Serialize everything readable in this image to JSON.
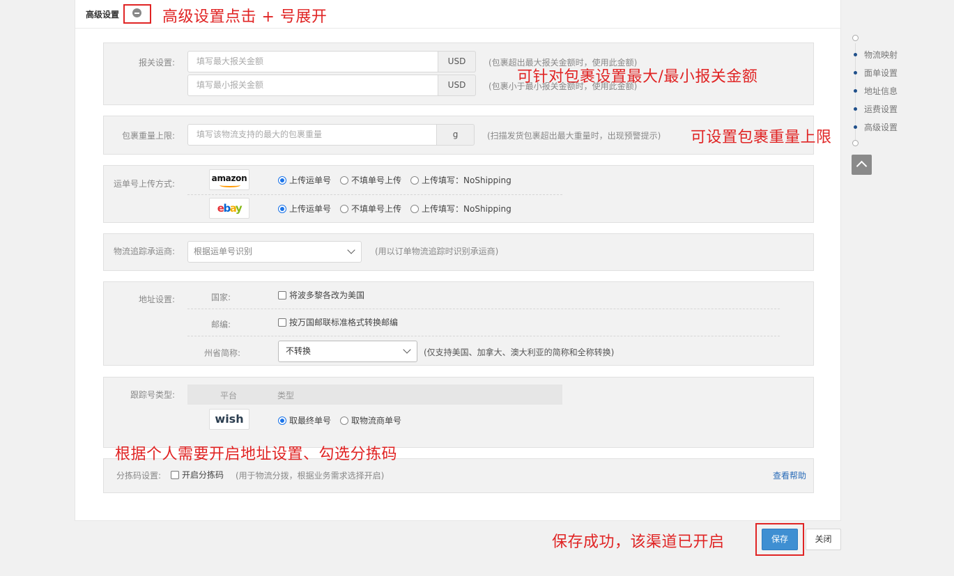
{
  "header": {
    "title": "高级设置",
    "toggle_icon": "minus-circle-icon"
  },
  "customs": {
    "label": "报关设置:",
    "max_placeholder": "填写最大报关金额",
    "min_placeholder": "填写最小报关金额",
    "currency": "USD",
    "max_hint": "(包裹超出最大报关金额时，使用此金额)",
    "min_hint": "(包裹小于最小报关金额时，使用此金额)"
  },
  "weight": {
    "label": "包裹重量上限:",
    "placeholder": "填写该物流支持的最大的包裹重量",
    "unit": "g",
    "hint": "(扫描发货包裹超出最大重量时，出现预警提示)"
  },
  "upload": {
    "label": "运单号上传方式:",
    "platforms": [
      {
        "logo": "amazon",
        "options": [
          "上传运单号",
          "不填单号上传",
          "上传填写：NoShipping"
        ],
        "selected": 0
      },
      {
        "logo": "ebay",
        "options": [
          "上传运单号",
          "不填单号上传",
          "上传填写：NoShipping"
        ],
        "selected": 0
      }
    ]
  },
  "carrier": {
    "label": "物流追踪承运商:",
    "value": "根据运单号识别",
    "hint": "(用以订单物流追踪时识别承运商)"
  },
  "address": {
    "label": "地址设置:",
    "country_label": "国家:",
    "country_option": "将波多黎各改为美国",
    "zip_label": "邮编:",
    "zip_option": "按万国邮联标准格式转换邮编",
    "state_label": "州省简称:",
    "state_value": "不转换",
    "state_hint": "(仅支持美国、加拿大、澳大利亚的简称和全称转换)"
  },
  "tracking": {
    "label": "跟踪号类型:",
    "col_platform": "平台",
    "col_type": "类型",
    "logo": "wish",
    "options": [
      "取最终单号",
      "取物流商单号"
    ],
    "selected": 0
  },
  "sorting": {
    "label": "分拣码设置:",
    "option": "开启分拣码",
    "hint": "(用于物流分拨，根据业务需求选择开启)",
    "help": "查看帮助"
  },
  "footer": {
    "save": "保存",
    "close": "关闭"
  },
  "sidenav": {
    "items": [
      "物流映射",
      "面单设置",
      "地址信息",
      "运费设置",
      "高级设置"
    ]
  },
  "annotations": {
    "expand": "高级设置点击 + 号展开",
    "customs": "可针对包裹设置最大/最小报关金额",
    "weight": "可设置包裹重量上限",
    "address": "根据个人需要开启地址设置、勾选分拣码",
    "save": "保存成功，该渠道已开启"
  },
  "colors": {
    "annotation": "#e02424",
    "primary": "#3f8fd2",
    "link": "#2a6cb8"
  }
}
